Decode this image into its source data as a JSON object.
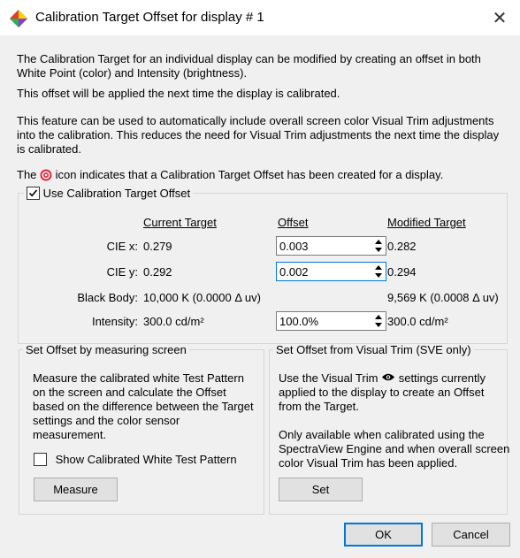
{
  "window": {
    "title": "Calibration Target Offset for display # 1",
    "close_glyph": "✕"
  },
  "intro": {
    "para1": "The Calibration Target for an individual display can be modified by creating an offset in both White Point (color) and Intensity (brightness).",
    "para2": "This offset will be applied the next time the display is calibrated.",
    "para3": "This feature can be used to automatically include overall screen color Visual Trim adjustments into the calibration. This reduces the need for Visual Trim adjustments the next time the display is calibrated.",
    "para4_prefix": "The",
    "para4_suffix": "icon indicates that a Calibration Target Offset has been created for a display."
  },
  "offset_group": {
    "checkbox_label": "Use Calibration Target Offset",
    "checked": true,
    "headers": {
      "current": "Current Target",
      "offset": "Offset",
      "modified": "Modified Target"
    },
    "rows": [
      {
        "label": "CIE x:",
        "current": "0.279",
        "offset": "0.003",
        "modified": "0.282"
      },
      {
        "label": "CIE y:",
        "current": "0.292",
        "offset": "0.002",
        "modified": "0.294"
      },
      {
        "label": "Black Body:",
        "current": "10,000 K (0.0000 Δ uv)",
        "modified": "9,569 K (0.0008 Δ uv)"
      },
      {
        "label": "Intensity:",
        "current": "300.0 cd/m²",
        "offset": "100.0%",
        "modified": "300.0 cd/m²"
      }
    ]
  },
  "measure_group": {
    "legend": "Set Offset by measuring screen",
    "text": "Measure the calibrated white Test Pattern on the screen and calculate the Offset based on the difference between the Target settings and the color sensor measurement.",
    "checkbox_label": "Show Calibrated White Test Pattern",
    "checked": false,
    "button": "Measure"
  },
  "trim_group": {
    "legend": "Set Offset from Visual Trim (SVE only)",
    "text1_a": "Use the Visual Trim",
    "text1_b": "settings currently applied to the display to create an Offset from the Target.",
    "text2": "Only available when calibrated using the SpectraView Engine and when overall screen color Visual Trim has been applied.",
    "button": "Set"
  },
  "footer": {
    "ok": "OK",
    "cancel": "Cancel"
  },
  "icons": {
    "app": "color-diamond-app-icon",
    "target": "red-target-icon",
    "eye": "eye-icon",
    "spin": "spin-up-down-icon"
  },
  "colors": {
    "accent": "#0078d7",
    "target_red": "#e0283c"
  }
}
